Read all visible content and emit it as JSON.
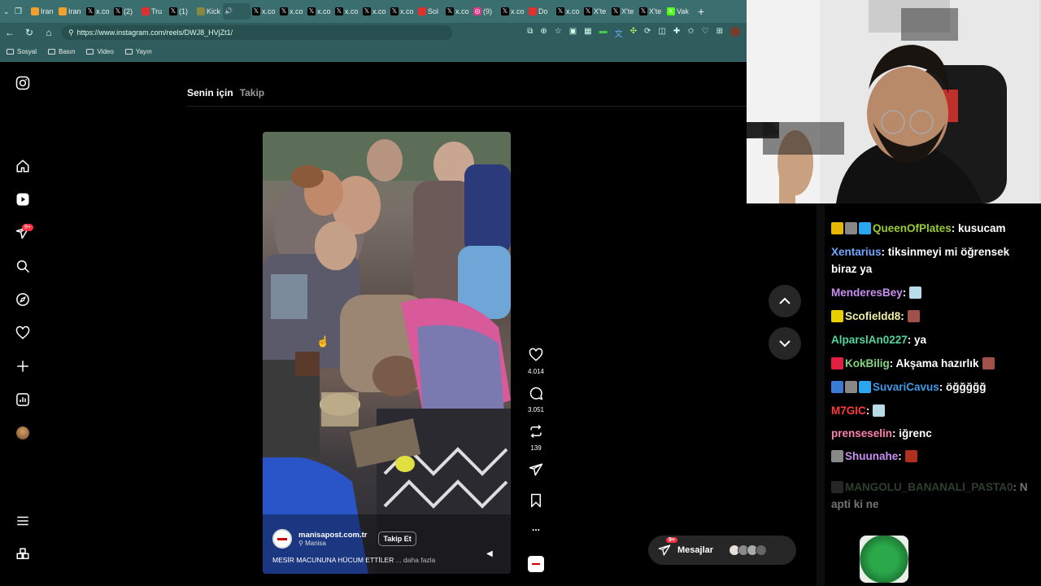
{
  "browser": {
    "tabs": [
      {
        "icon": "orange",
        "label": "Iran"
      },
      {
        "icon": "orange",
        "label": "Iran"
      },
      {
        "icon": "x",
        "label": "x.co"
      },
      {
        "icon": "x",
        "label": "(2)"
      },
      {
        "icon": "red",
        "label": "Tru"
      },
      {
        "icon": "x",
        "label": "(1)"
      },
      {
        "icon": "circle",
        "label": "Kick"
      },
      {
        "icon": "speaker",
        "label": ""
      },
      {
        "icon": "x",
        "label": "x.co"
      },
      {
        "icon": "x",
        "label": "x.co"
      },
      {
        "icon": "x",
        "label": "x.co"
      },
      {
        "icon": "x",
        "label": "x.co"
      },
      {
        "icon": "x",
        "label": "x.co"
      },
      {
        "icon": "x",
        "label": "x.co"
      },
      {
        "icon": "red",
        "label": "Sol"
      },
      {
        "icon": "x",
        "label": "x.co"
      },
      {
        "icon": "insta",
        "label": "(9)"
      },
      {
        "icon": "x",
        "label": "x.co"
      },
      {
        "icon": "red",
        "label": "Do"
      },
      {
        "icon": "x",
        "label": "x.co"
      },
      {
        "icon": "x",
        "label": "X'te"
      },
      {
        "icon": "x",
        "label": "X'te"
      },
      {
        "icon": "x",
        "label": "X'te"
      },
      {
        "icon": "kick",
        "label": "Vak"
      }
    ],
    "new_tab": "+",
    "url": "https://www.instagram.com/reels/DWJ8_HVjZt1/",
    "bookmarks": [
      "Sosyal",
      "Basın",
      "Video",
      "Yayın"
    ]
  },
  "instagram": {
    "feed_tabs": {
      "for_you": "Senin için",
      "following": "Takip"
    },
    "notification_badge": "9+",
    "reel": {
      "account": "manisapost.com.tr",
      "location": "Manisa",
      "follow_label": "Takip Et",
      "caption": "MESİR MACUNUNA HÜCUM ETTİLER",
      "more": "... daha fazla"
    },
    "actions": {
      "likes": "4.014",
      "comments": "3.051",
      "reposts": "139",
      "more": "..."
    },
    "messages": {
      "label": "Mesajlar",
      "badge": "9+"
    }
  },
  "chat": [
    {
      "badges": [
        "#e8b800",
        "#888",
        "#2aa7f0"
      ],
      "user": "QueenOfPlates",
      "color": "#9acd32",
      "text": "kusucam"
    },
    {
      "badges": [],
      "user": "Xentarius",
      "color": "#6fa8ff",
      "text": "tiksinmeyi mi öğrensek biraz ya"
    },
    {
      "badges": [],
      "user": "MenderesBey",
      "color": "#c98ef0",
      "text": "",
      "emote": "#b8dbe8"
    },
    {
      "badges": [
        "#e8d000"
      ],
      "user": "Scofieldd8",
      "color": "#f0f0a0",
      "text": "",
      "emote": "#a0524a"
    },
    {
      "badges": [],
      "user": "AlparslAn0227",
      "color": "#4fd69c",
      "text": "ya"
    },
    {
      "badges": [
        "#e02040"
      ],
      "user": "KokBilig",
      "color": "#7fd67f",
      "text": "Akşama hazırlık",
      "emote_after": "#a0524a"
    },
    {
      "badges": [
        "#3a7bd5",
        "#888",
        "#2aa7f0"
      ],
      "user": "SuvariCavus",
      "color": "#3d9be9",
      "text": "öğğğğğ"
    },
    {
      "badges": [],
      "user": "M7GIC",
      "color": "#ff3a3a",
      "text": "",
      "emote": "#b8dbe8"
    },
    {
      "badges": [],
      "user": "prenseselin",
      "color": "#ff7fb0",
      "text": "iğrenc"
    },
    {
      "badges": [
        "#888"
      ],
      "user": "Shuunahe",
      "color": "#c98ef0",
      "text": "",
      "emote": "#b03020"
    },
    {
      "badges": [
        "#555"
      ],
      "user": "MANGOLU_BANANALI_PASTA0",
      "color": "#6a8a6a",
      "text": "N apti ki ne",
      "faded": true
    }
  ]
}
